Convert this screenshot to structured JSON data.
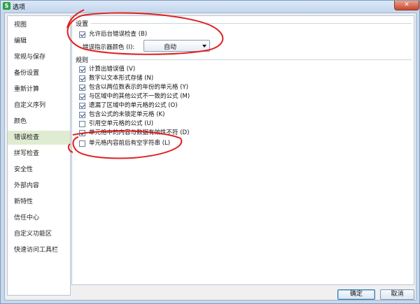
{
  "window": {
    "title": "选项",
    "app_icon_text": "S",
    "close_label": "✕"
  },
  "sidebar": {
    "items": [
      {
        "label": "视图"
      },
      {
        "label": "编辑"
      },
      {
        "label": "常规与保存"
      },
      {
        "label": "备份设置"
      },
      {
        "label": "重新计算"
      },
      {
        "label": "自定义序列"
      },
      {
        "label": "颜色"
      },
      {
        "label": "错误检查",
        "active": true
      },
      {
        "label": "拼写检查"
      },
      {
        "label": "安全性"
      },
      {
        "label": "外部内容"
      },
      {
        "label": "新特性"
      },
      {
        "label": "信任中心"
      },
      {
        "label": "自定义功能区"
      },
      {
        "label": "快速访问工具栏"
      }
    ]
  },
  "settings": {
    "title": "设置",
    "background_check_label": "允许后台错误检查 (B)",
    "background_check_checked": true,
    "indicator_color_label": "错误指示器颜色 (I):",
    "indicator_color_value": "自动"
  },
  "rules": {
    "title": "规则",
    "items": [
      {
        "label": "计算出错误值 (V)",
        "checked": true
      },
      {
        "label": "数字以文本形式存储 (N)",
        "checked": true
      },
      {
        "label": "包含以两位数表示的年份的单元格 (Y)",
        "checked": true
      },
      {
        "label": "与区域中的其他公式不一致的公式 (M)",
        "checked": true
      },
      {
        "label": "遗漏了区域中的单元格的公式 (O)",
        "checked": true
      },
      {
        "label": "包含公式的未锁定单元格 (K)",
        "checked": true
      },
      {
        "label": "引用空单元格的公式 (U)",
        "checked": false
      },
      {
        "label": "单元格中的内容与数据有效性不符 (D)",
        "checked": true
      },
      {
        "label": "单元格内容前后有空字符串 (L)",
        "checked": false
      }
    ]
  },
  "buttons": {
    "ok": "确定",
    "cancel": "取消"
  },
  "colors": {
    "annotation": "#e02020",
    "active_nav": "#e0ecd2",
    "title_bar": "#c7d8ec"
  }
}
